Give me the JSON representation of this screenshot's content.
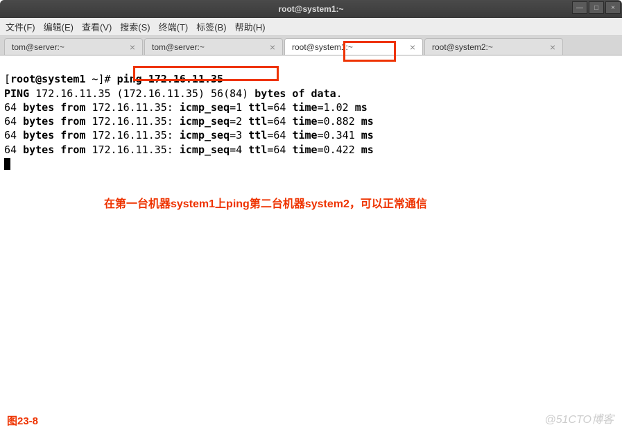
{
  "window": {
    "title": "root@system1:~",
    "min_icon": "—",
    "max_icon": "□",
    "close_icon": "×"
  },
  "menu": {
    "file": "文件(F)",
    "edit": "编辑(E)",
    "view": "查看(V)",
    "search": "搜索(S)",
    "terminal": "终端(T)",
    "tabs": "标签(B)",
    "help": "帮助(H)"
  },
  "tabs": [
    {
      "label": "tom@server:~",
      "close": "×"
    },
    {
      "label": "tom@server:~",
      "close": "×"
    },
    {
      "label": "root@system1:~",
      "close": "×"
    },
    {
      "label": "root@system2:~",
      "close": "×"
    }
  ],
  "terminal": {
    "prompt_open": "[",
    "prompt_user": "root@system1",
    "prompt_path": " ~]#",
    "command": "ping 172.16.11.35",
    "line1_a": "PING ",
    "line1_b": "172.16.11.35 (172.16.11.35) 56(84) ",
    "line1_c": "bytes of data",
    "line1_d": ".",
    "reply1_a": "64 ",
    "reply1_b": "bytes from ",
    "reply1_c": "172.16.11.35: ",
    "reply1_d": "icmp_seq",
    "reply1_e": "=1 ",
    "reply1_f": "ttl",
    "reply1_g": "=64 ",
    "reply1_h": "time",
    "reply1_i": "=1.02 ",
    "reply1_j": "ms",
    "reply2_a": "64 ",
    "reply2_b": "bytes from ",
    "reply2_c": "172.16.11.35: ",
    "reply2_d": "icmp_seq",
    "reply2_e": "=2 ",
    "reply2_f": "ttl",
    "reply2_g": "=64 ",
    "reply2_h": "time",
    "reply2_i": "=0.882 ",
    "reply2_j": "ms",
    "reply3_a": "64 ",
    "reply3_b": "bytes from ",
    "reply3_c": "172.16.11.35: ",
    "reply3_d": "icmp_seq",
    "reply3_e": "=3 ",
    "reply3_f": "ttl",
    "reply3_g": "=64 ",
    "reply3_h": "time",
    "reply3_i": "=0.341 ",
    "reply3_j": "ms",
    "reply4_a": "64 ",
    "reply4_b": "bytes from ",
    "reply4_c": "172.16.11.35: ",
    "reply4_d": "icmp_seq",
    "reply4_e": "=4 ",
    "reply4_f": "ttl",
    "reply4_g": "=64 ",
    "reply4_h": "time",
    "reply4_i": "=0.422 ",
    "reply4_j": "ms"
  },
  "annotation": {
    "text": "在第一台机器system1上ping第二台机器system2，可以正常通信",
    "figure": "图23-8"
  },
  "watermark": "@51CTO博客"
}
